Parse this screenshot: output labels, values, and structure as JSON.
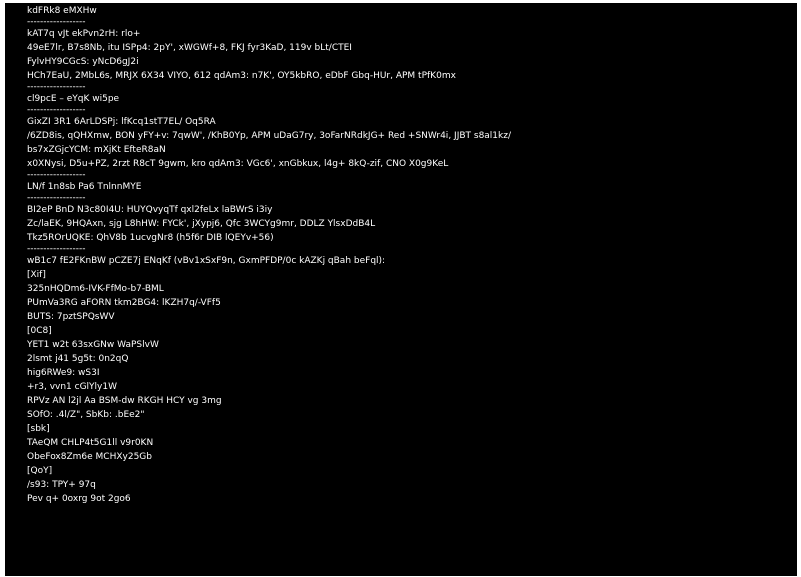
{
  "console": {
    "title": "kdFRk8 eMXHw",
    "separator": "------------------",
    "sections": [
      {
        "lines": [
          "kAT7q vJt ekPvn2rH: rlo+",
          "49eE7lr, B7s8Nb, itu ISPp4: 2pY', xWGWf+8, FKJ fyr3KaD, 119v bLt/CTEI",
          "FylvHY9CGcS: yNcD6gJ2i",
          "HCh7EaU, 2MbL6s, MRJX 6X34 VIYO, 612 qdAm3: n7K', OY5kbRO, eDbF Gbq-HUr, APM tPfK0mx"
        ]
      },
      {
        "lines": [
          "cl9pcE – eYqK wi5pe"
        ]
      },
      {
        "lines": [
          "GixZI 3R1 6ArLDSPj: lfKcq1stT7EL/ Oq5RA",
          "/6ZD8is, qQHXmw, BON yFY+v: 7qwW', /KhB0Yp, APM uDaG7ry, 3oFarNRdkJG+ Red +SNWr4i, JJBT s8al1kz/",
          "bs7xZGjcYCM: mXjKt EfteR8aN",
          "x0XNysi, D5u+PZ, 2rzt R8cT 9gwm, kro qdAm3: VGc6', xnGbkux, l4g+ 8kQ-zif, CNO X0g9KeL"
        ]
      },
      {
        "lines": [
          "LN/f 1n8sb Pa6 TnlnnMYE"
        ]
      },
      {
        "lines": [
          "BI2eP BnD N3c80I4U: HUYQvyqTf qxl2feLx laBWrS i3iy",
          "Zc/laEK, 9HQAxn, sjg L8hHW: FYCk', jXypj6, Qfc 3WCYg9mr, DDLZ YlsxDdB4L",
          "Tkz5ROrUQKE: QhV8b 1ucvgNr8 (h5f6r DIB lQEYv+56)"
        ]
      },
      {
        "lines": [
          "wB1c7 fE2FKnBW pCZE7j ENqKf (vBv1xSxF9n, GxmPFDP/0c kAZKj qBah beFql):",
          "[Xif]",
          "325nHQDm6-IVK-FfMo-b7-BML",
          "PUmVa3RG aFORN tkm2BG4: lKZH7q/-VFf5",
          "BUTS: 7pztSPQsWV",
          "[0C8]",
          "YET1 w2t 63sxGNw WaPSlvW",
          "2lsmt j41 5g5t: 0n2qQ",
          "hig6RWe9: wS3I",
          "+r3, vvn1 cGlYly1W",
          "RPVz AN l2jl Aa BSM-dw RKGH HCY vg 3mg",
          "SOfO: .4l/Z\", SbKb: .bEe2\"",
          "[sbk]",
          "TAeQM CHLP4t5G1ll v9r0KN",
          "ObeFox8Zm6e MCHXy25Gb",
          "[QoY]",
          "/s93: TPY+ 97q",
          "Pev q+ 0oxrg 9ot 2go6"
        ]
      }
    ]
  }
}
